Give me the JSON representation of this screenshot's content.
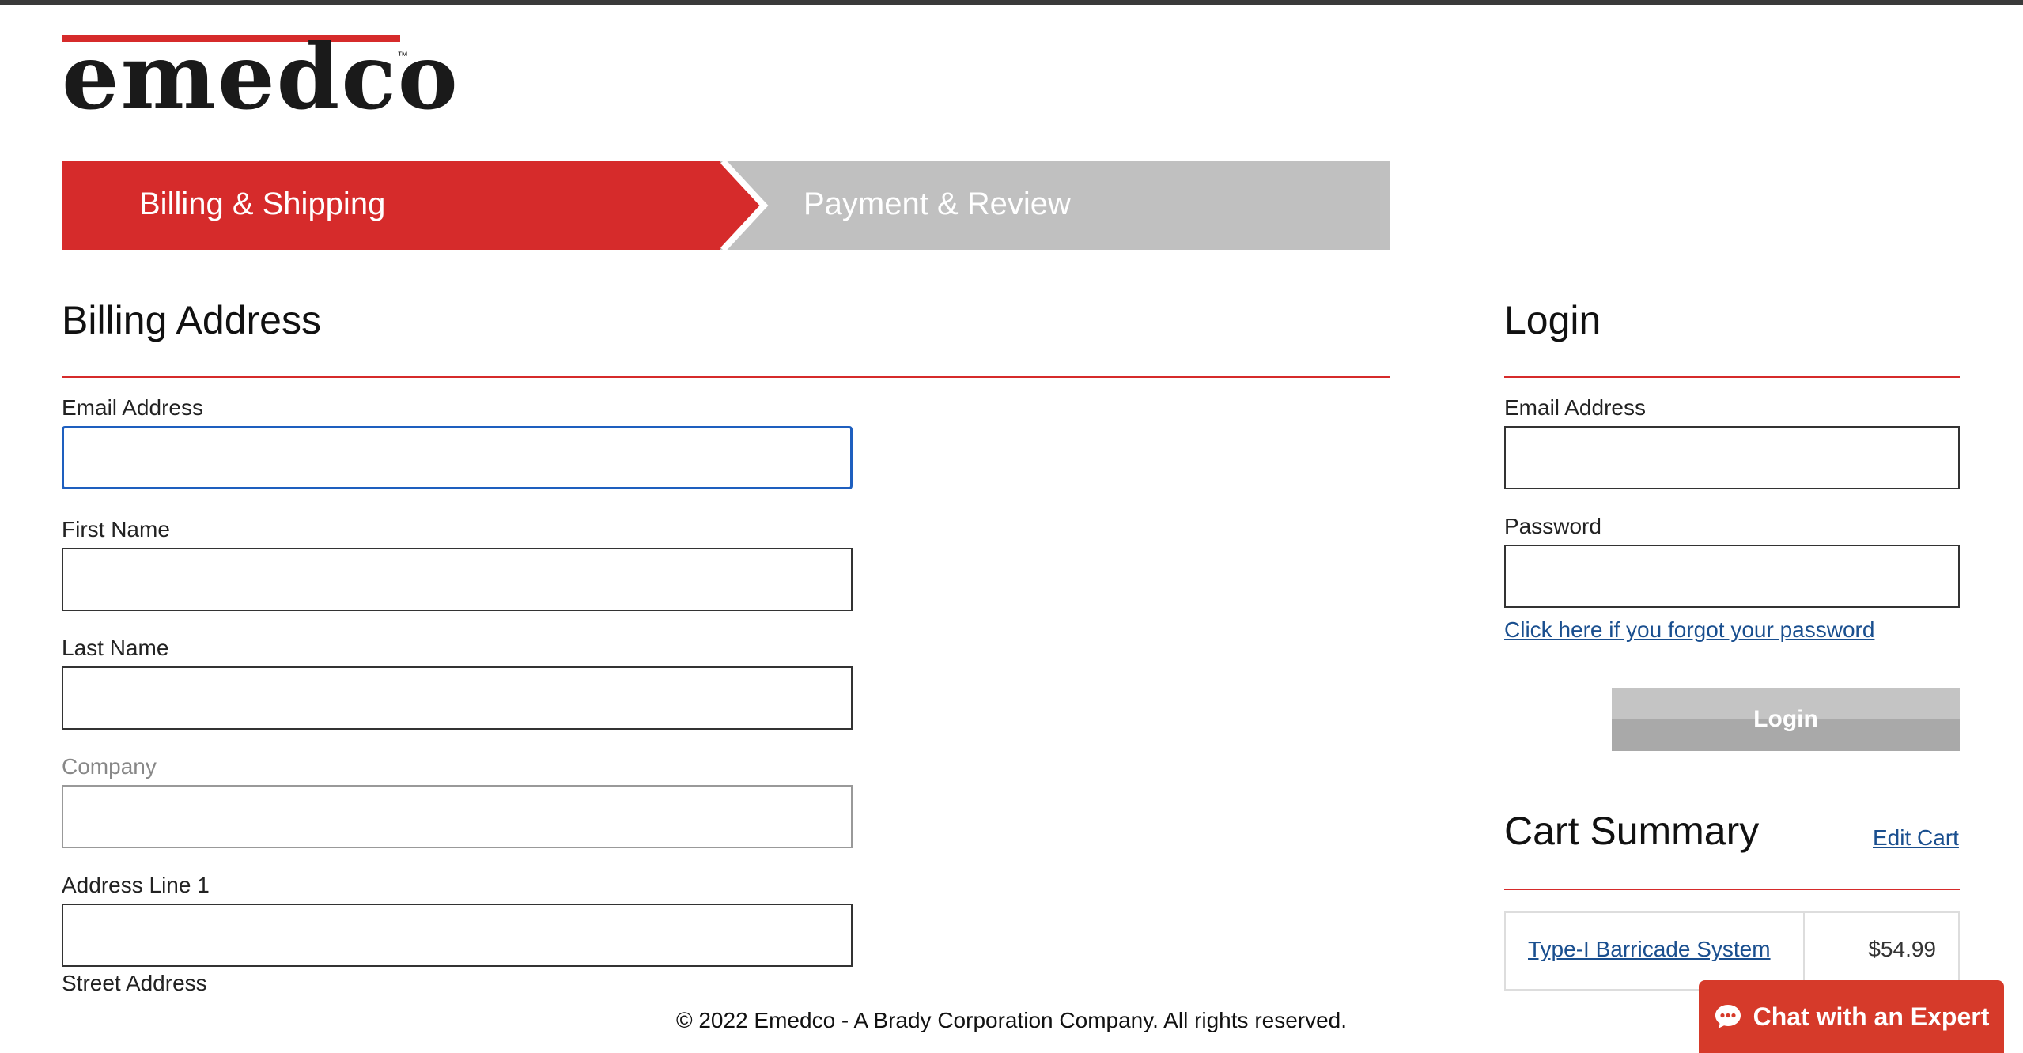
{
  "brand": {
    "logo_text": "emedco",
    "trademark": "™",
    "accent_color": "#d62b2b"
  },
  "steps": [
    {
      "label": "Billing & Shipping",
      "active": true,
      "color": "#d62b2b"
    },
    {
      "label": "Payment & Review",
      "active": false,
      "color": "#c0c0c0"
    }
  ],
  "billing": {
    "title": "Billing Address",
    "fields": {
      "email": {
        "label": "Email Address",
        "value": ""
      },
      "first_name": {
        "label": "First Name",
        "value": ""
      },
      "last_name": {
        "label": "Last Name",
        "value": ""
      },
      "company": {
        "label": "Company",
        "value": ""
      },
      "address1": {
        "label": "Address Line 1",
        "value": ""
      },
      "street_hint": "Street Address"
    }
  },
  "login": {
    "title": "Login",
    "email_label": "Email Address",
    "password_label": "Password",
    "forgot_link": "Click here if you forgot your password",
    "button_label": "Login"
  },
  "cart": {
    "title": "Cart Summary",
    "edit_link": "Edit Cart",
    "items": [
      {
        "name": "Type-I Barricade System",
        "price": "$54.99"
      }
    ]
  },
  "footer": {
    "copyright": "© 2022 Emedco - A Brady Corporation Company. All rights reserved."
  },
  "chat": {
    "label": "Chat with an Expert",
    "icon": "chat-bubble-icon",
    "color": "#d63a2a"
  }
}
